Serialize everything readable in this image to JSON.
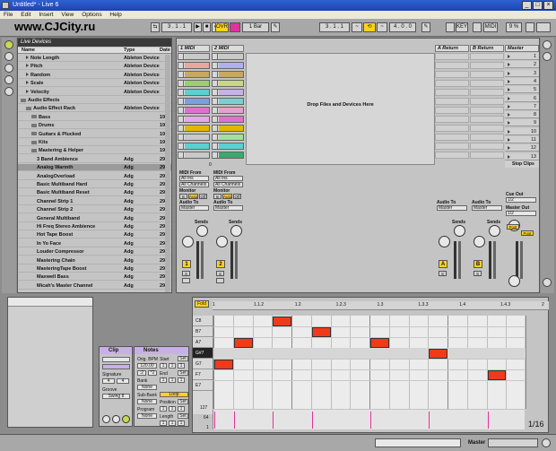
{
  "window": {
    "title": "Untitled* - Live 6"
  },
  "menu": [
    "File",
    "Edit",
    "Insert",
    "View",
    "Options",
    "Help"
  ],
  "watermark": "www.CJCity.ru",
  "transport": {
    "pos1": "3 . 1 . 1",
    "ovr": "OVR",
    "quant": "1 Bar",
    "pos2": "3 . 1 . 1",
    "len": "4 . 0 . 0",
    "key": "KEY",
    "midi": "MIDI",
    "pct": "9 %"
  },
  "browser": {
    "title": "Live Devices",
    "headers": {
      "name": "Name",
      "type": "Type",
      "date": "Date"
    },
    "rows": [
      {
        "name": "Note Length",
        "type": "Ableton Device",
        "date": "",
        "indent": 1,
        "icon": "tri"
      },
      {
        "name": "Pitch",
        "type": "Ableton Device",
        "date": "",
        "indent": 1,
        "icon": "tri"
      },
      {
        "name": "Random",
        "type": "Ableton Device",
        "date": "",
        "indent": 1,
        "icon": "tri"
      },
      {
        "name": "Scale",
        "type": "Ableton Device",
        "date": "",
        "indent": 1,
        "icon": "tri"
      },
      {
        "name": "Velocity",
        "type": "Ableton Device",
        "date": "",
        "indent": 1,
        "icon": "tri"
      },
      {
        "name": "Audio Effects",
        "type": "",
        "date": "",
        "indent": 0,
        "icon": "fold"
      },
      {
        "name": "Audio Effect Rack",
        "type": "Ableton Device",
        "date": "",
        "indent": 1,
        "icon": "fold"
      },
      {
        "name": "Bass",
        "type": "",
        "date": "19.1",
        "indent": 2,
        "icon": "fold"
      },
      {
        "name": "Drums",
        "type": "",
        "date": "19.1",
        "indent": 2,
        "icon": "fold"
      },
      {
        "name": "Guitars & Plucked",
        "type": "",
        "date": "19.1",
        "indent": 2,
        "icon": "fold"
      },
      {
        "name": "Kits",
        "type": "",
        "date": "19.1",
        "indent": 2,
        "icon": "fold"
      },
      {
        "name": "Mastering & Helper",
        "type": "",
        "date": "19.1",
        "indent": 2,
        "icon": "fold"
      },
      {
        "name": "3 Band Ambience",
        "type": "Adg",
        "date": "29.0",
        "indent": 3,
        "icon": "none"
      },
      {
        "name": "Analog Warmth",
        "type": "Adg",
        "date": "29.0",
        "indent": 3,
        "icon": "none",
        "sel": true
      },
      {
        "name": "AnalogOverload",
        "type": "Adg",
        "date": "29.0",
        "indent": 3,
        "icon": "none"
      },
      {
        "name": "Basic Multiband Hard",
        "type": "Adg",
        "date": "29.0",
        "indent": 3,
        "icon": "none"
      },
      {
        "name": "Basic Multiband Reset",
        "type": "Adg",
        "date": "29.0",
        "indent": 3,
        "icon": "none"
      },
      {
        "name": "Channel Strip 1",
        "type": "Adg",
        "date": "29.0",
        "indent": 3,
        "icon": "none"
      },
      {
        "name": "Channel Strip 2",
        "type": "Adg",
        "date": "29.0",
        "indent": 3,
        "icon": "none"
      },
      {
        "name": "General Multiband",
        "type": "Adg",
        "date": "29.0",
        "indent": 3,
        "icon": "none"
      },
      {
        "name": "Hi Freq Stereo Ambience",
        "type": "Adg",
        "date": "29.0",
        "indent": 3,
        "icon": "none"
      },
      {
        "name": "Hot Tape Boost",
        "type": "Adg",
        "date": "29.0",
        "indent": 3,
        "icon": "none"
      },
      {
        "name": "In Yo Face",
        "type": "Adg",
        "date": "29.0",
        "indent": 3,
        "icon": "none"
      },
      {
        "name": "Louder Compressor",
        "type": "Adg",
        "date": "29.0",
        "indent": 3,
        "icon": "none"
      },
      {
        "name": "Mastering Chain",
        "type": "Adg",
        "date": "29.0",
        "indent": 3,
        "icon": "none"
      },
      {
        "name": "MasteringTape Boost",
        "type": "Adg",
        "date": "29.0",
        "indent": 3,
        "icon": "none"
      },
      {
        "name": "Maxwell Bass",
        "type": "Adg",
        "date": "29.0",
        "indent": 3,
        "icon": "none"
      },
      {
        "name": "Micah's Master Channel",
        "type": "Adg",
        "date": "29.0",
        "indent": 3,
        "icon": "none"
      }
    ]
  },
  "session": {
    "tracks": [
      {
        "name": "1 MIDI",
        "num": "1"
      },
      {
        "name": "2 MIDI",
        "num": "2"
      }
    ],
    "returns": [
      {
        "name": "A Return",
        "letter": "A"
      },
      {
        "name": "B Return",
        "letter": "B"
      }
    ],
    "master": "Master",
    "drop_hint": "Drop Files and Devices Here",
    "scenes": [
      "1",
      "2",
      "3",
      "4",
      "5",
      "6",
      "7",
      "8",
      "9",
      "10",
      "11",
      "12",
      "13"
    ],
    "clips1": [
      "#c9c9c9",
      "#e8a8a0",
      "#c8a860",
      "#9ad070",
      "#5ad0d0",
      "#7aa0e0",
      "#e070d0",
      "#e8a8e8",
      "#e0b800",
      "#c9c9c9",
      "#5ad0d0",
      "#c9c9c9"
    ],
    "clips2": [
      "#c9c9c9",
      "#b0b0f0",
      "#c8a860",
      "#c8d880",
      "#c8b0e8",
      "#7ad0d0",
      "#e8a0c8",
      "#e070d0",
      "#e0b800",
      "#a0e0a0",
      "#5ad0d0",
      "#3aa870"
    ],
    "labels": {
      "midi_from": "MIDI From",
      "all_ins": "All Ins",
      "all_channels": "All Channels",
      "monitor": "Monitor",
      "in": "In",
      "auto": "Auto",
      "off": "Off",
      "audio_to": "Audio To",
      "sends": "Sends",
      "stop_clips": "Stop Clips",
      "cue_out": "Cue Out",
      "cue_val": "1/2",
      "master_out": "Master Out",
      "master_val": "1/2",
      "pre": "Post",
      "post": "Post",
      "sel_count": "0",
      "s": "S",
      "master_opt": "Master"
    }
  },
  "clip": {
    "title": "Clip",
    "signature": "Signature",
    "sig_num": "4",
    "sig_den": "4",
    "groove": "Groove",
    "groove_val": "Swing 8"
  },
  "notes": {
    "title": "Notes",
    "orig_bpm": "Orig. BPM",
    "bpm": "120.00",
    "start": "Start",
    "end": "End",
    "bank": "Bank",
    "bank_val": "None",
    "sub_bank": "Sub-Bank",
    "program": "Program",
    "none": "None",
    "loop": "Loop",
    "position": "Position",
    "length": "Length",
    "set": "Set",
    "half": ":2",
    "dbl": "*2",
    "one": "1",
    "val_1": "1",
    "val_4": "4"
  },
  "editor": {
    "fold": "Fold",
    "ruler": [
      "1",
      "1.1.2",
      "1.2",
      "1.2.3",
      "1.3",
      "1.3.3",
      "1.4",
      "1.4.3",
      "2"
    ],
    "keys": [
      "C8",
      "B7",
      "A7",
      "G#7",
      "G7",
      "F7",
      "E7"
    ],
    "vel_max": "127",
    "vel_mid": "64",
    "vel_min": "1",
    "page": "1/16"
  },
  "status": {
    "master": "Master"
  }
}
